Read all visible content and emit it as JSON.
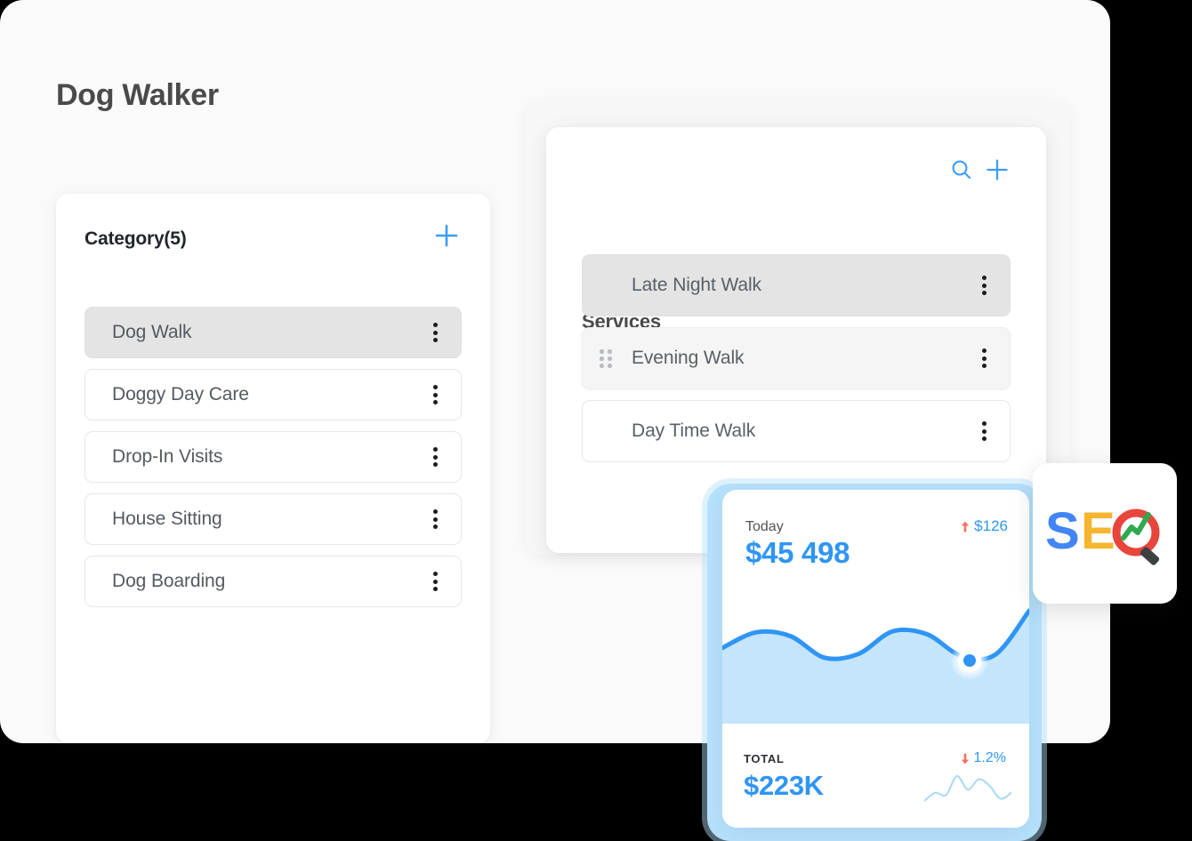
{
  "page": {
    "title": "Dog Walker"
  },
  "category_panel": {
    "title": "Category(5)",
    "add_icon": "plus-icon",
    "items": [
      {
        "label": "Dog Walk",
        "selected": true
      },
      {
        "label": "Doggy Day Care",
        "selected": false
      },
      {
        "label": "Drop-In Visits",
        "selected": false
      },
      {
        "label": "House Sitting",
        "selected": false
      },
      {
        "label": "Dog Boarding",
        "selected": false
      }
    ]
  },
  "services_panel": {
    "title": "Services",
    "search_icon": "search-icon",
    "add_icon": "plus-icon",
    "items": [
      {
        "label": "Late Night Walk",
        "state": "selected",
        "handle": false
      },
      {
        "label": "Evening Walk",
        "state": "dragging",
        "handle": true
      },
      {
        "label": "Day Time Walk",
        "state": "default",
        "handle": false
      }
    ]
  },
  "analytics_card": {
    "today_label": "Today",
    "today_value": "$45 498",
    "today_delta": "$126",
    "today_delta_direction": "up",
    "total_label": "TOTAL",
    "total_value": "$223K",
    "total_delta": "1.2%",
    "total_delta_direction": "down",
    "accent_color": "#2f95f5",
    "delta_up_color": "#f4705e",
    "delta_down_color": "#f4705e",
    "area_fill_color": "#c4e5fb",
    "frame_color": "#b6e2fd"
  },
  "seo_tile": {
    "letters": [
      "S",
      "E",
      "O"
    ],
    "letter_colors": [
      "#4285f4",
      "#f5b52e",
      "#e8453c"
    ],
    "arrow_color": "#2fa84f",
    "handle_color": "#3c4043"
  },
  "chart_data": {
    "type": "area",
    "title": "",
    "xlabel": "",
    "ylabel": "",
    "x": [
      0,
      1,
      2,
      3,
      4,
      5,
      6,
      7,
      8,
      9
    ],
    "values": [
      62,
      78,
      74,
      52,
      56,
      79,
      76,
      54,
      55,
      100
    ],
    "ylim": [
      0,
      100
    ],
    "grid": false,
    "legend": false,
    "line_color": "#2f95f5",
    "fill_color": "#c4e5fb",
    "marker_index": 8,
    "marker_label": "$45 498"
  },
  "sparkline_data": {
    "type": "line",
    "x": [
      0,
      1,
      2,
      3,
      4,
      5,
      6,
      7,
      8
    ],
    "values": [
      30,
      52,
      46,
      96,
      60,
      88,
      70,
      36,
      52
    ],
    "line_color": "#a9d9f8",
    "grid": false,
    "legend": false
  }
}
